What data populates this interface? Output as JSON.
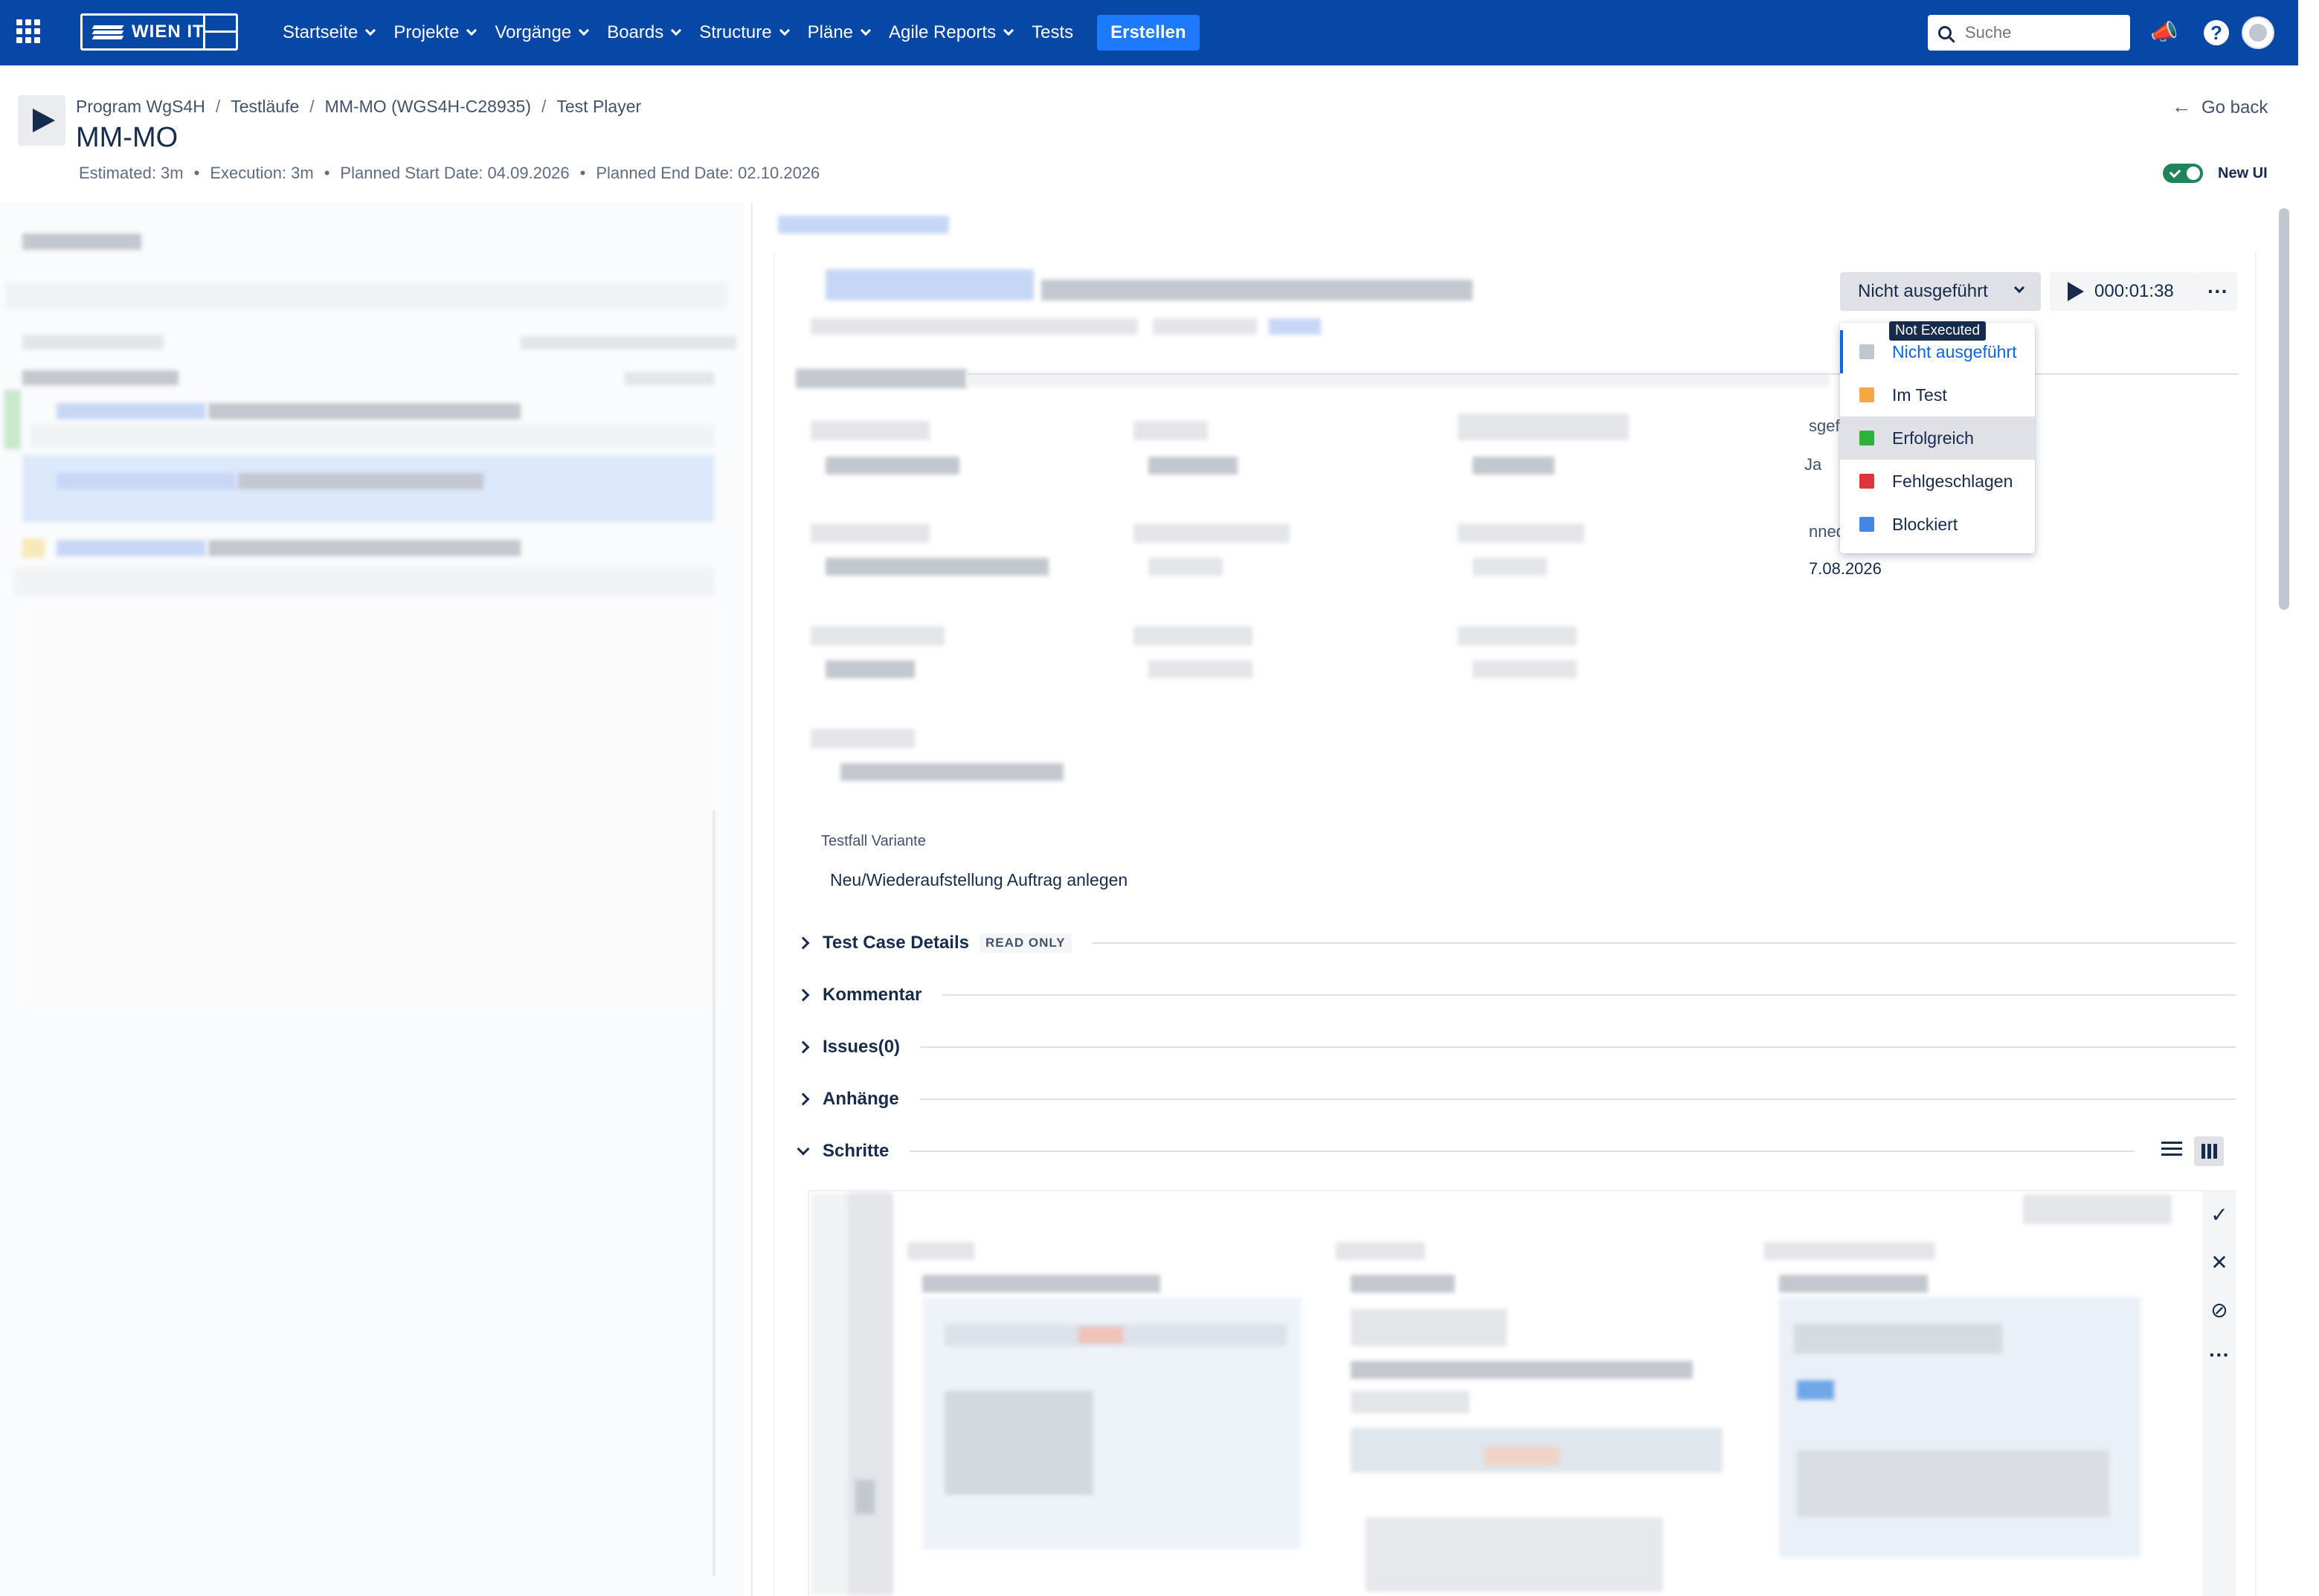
{
  "nav": {
    "logo_text": "WIEN IT",
    "items": [
      "Startseite",
      "Projekte",
      "Vorgänge",
      "Boards",
      "Structure",
      "Pläne",
      "Agile Reports",
      "Tests"
    ],
    "create_label": "Erstellen",
    "search_placeholder": "Suche",
    "brand_color": "#0747a6"
  },
  "header": {
    "breadcrumb": [
      "Program WgS4H",
      "Testläufe",
      "MM-MO (WGS4H-C28935)",
      "Test Player"
    ],
    "title": "MM-MO",
    "meta": [
      "Estimated: 3m",
      "Execution: 3m",
      "Planned Start Date: 04.09.2026",
      "Planned End Date: 02.10.2026"
    ],
    "go_back": "Go back",
    "new_ui_label": "New UI"
  },
  "player": {
    "status_label": "Nicht ausgeführt",
    "timer": "000:01:38",
    "tooltip": "Not Executed",
    "status_options": [
      {
        "label": "Nicht ausgeführt",
        "color": "#c1c7d0"
      },
      {
        "label": "Im Test",
        "color": "#f5a742"
      },
      {
        "label": "Erfolgreich",
        "color": "#2eb13c"
      },
      {
        "label": "Fehlgeschlagen",
        "color": "#e0343b"
      },
      {
        "label": "Blockiert",
        "color": "#4585e8"
      }
    ]
  },
  "partial": {
    "a": "sgefi",
    "b": "Ja",
    "c": "nned",
    "d": "7.08.2026"
  },
  "fields": {
    "variant_label": "Testfall Variante",
    "variant_value": "Neu/Wiederaufstellung Auftrag anlegen"
  },
  "sections": {
    "details": "Test Case Details",
    "details_badge": "READ ONLY",
    "comment": "Kommentar",
    "issues": "Issues(0)",
    "attachments": "Anhänge",
    "steps": "Schritte"
  }
}
